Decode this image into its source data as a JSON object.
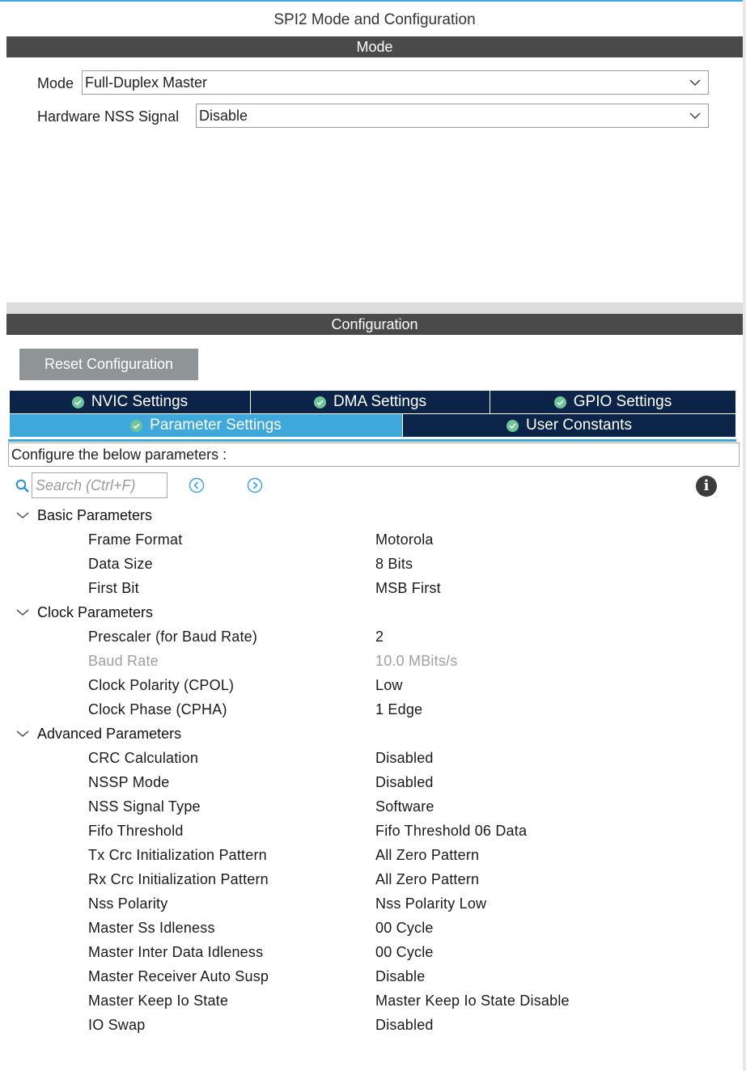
{
  "window": {
    "title": "SPI2 Mode and Configuration"
  },
  "mode_section": {
    "header": "Mode",
    "mode": {
      "label": "Mode",
      "value": "Full-Duplex Master"
    },
    "nss": {
      "label": "Hardware NSS Signal",
      "value": "Disable"
    }
  },
  "config_section": {
    "header": "Configuration",
    "reset_label": "Reset Configuration",
    "tabs": [
      {
        "label": "NVIC Settings",
        "active": false
      },
      {
        "label": "DMA Settings",
        "active": false
      },
      {
        "label": "GPIO Settings",
        "active": false
      },
      {
        "label": "Parameter Settings",
        "active": true
      },
      {
        "label": "User Constants",
        "active": false
      }
    ],
    "description": "Configure the below parameters :",
    "search": {
      "placeholder": "Search (Ctrl+F)",
      "value": ""
    },
    "groups": [
      {
        "label": "Basic Parameters",
        "params": [
          {
            "name": "Frame Format",
            "value": "Motorola",
            "disabled": false
          },
          {
            "name": "Data Size",
            "value": "8 Bits",
            "disabled": false
          },
          {
            "name": "First Bit",
            "value": "MSB First",
            "disabled": false
          }
        ]
      },
      {
        "label": "Clock Parameters",
        "params": [
          {
            "name": "Prescaler (for Baud Rate)",
            "value": "2",
            "disabled": false
          },
          {
            "name": "Baud Rate",
            "value": "10.0 MBits/s",
            "disabled": true
          },
          {
            "name": "Clock Polarity (CPOL)",
            "value": "Low",
            "disabled": false
          },
          {
            "name": "Clock Phase (CPHA)",
            "value": "1 Edge",
            "disabled": false
          }
        ]
      },
      {
        "label": "Advanced Parameters",
        "params": [
          {
            "name": "CRC Calculation",
            "value": "Disabled",
            "disabled": false
          },
          {
            "name": "NSSP Mode",
            "value": "Disabled",
            "disabled": false
          },
          {
            "name": "NSS Signal Type",
            "value": "Software",
            "disabled": false
          },
          {
            "name": "Fifo Threshold",
            "value": "Fifo Threshold 06 Data",
            "disabled": false
          },
          {
            "name": "Tx Crc Initialization Pattern",
            "value": "All Zero Pattern",
            "disabled": false
          },
          {
            "name": "Rx Crc Initialization Pattern",
            "value": "All Zero Pattern",
            "disabled": false
          },
          {
            "name": "Nss Polarity",
            "value": "Nss Polarity Low",
            "disabled": false
          },
          {
            "name": "Master Ss Idleness",
            "value": "00 Cycle",
            "disabled": false
          },
          {
            "name": "Master Inter Data Idleness",
            "value": "00 Cycle",
            "disabled": false
          },
          {
            "name": "Master Receiver Auto Susp",
            "value": "Disable",
            "disabled": false
          },
          {
            "name": "Master Keep Io State",
            "value": "Master Keep Io State Disable",
            "disabled": false
          },
          {
            "name": "IO Swap",
            "value": "Disabled",
            "disabled": false
          }
        ]
      }
    ]
  },
  "icons": {
    "check": "check-circle-icon",
    "search": "search-icon",
    "prev": "previous-match-icon",
    "next": "next-match-icon",
    "info": "info-icon",
    "chevron": "chevron-down-icon"
  },
  "colors": {
    "header_bg": "#4a4a4a",
    "tab_bg": "#0b2447",
    "tab_active_bg": "#3ea8da",
    "check_green": "#6ec59a",
    "reset_bg": "#8f9497",
    "disabled_text": "#a0a0a0"
  }
}
